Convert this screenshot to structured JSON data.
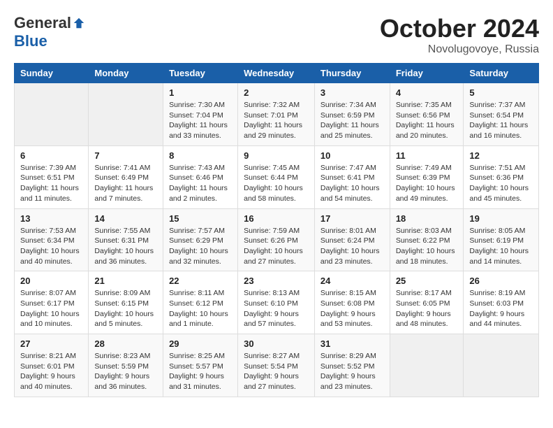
{
  "logo": {
    "general": "General",
    "blue": "Blue"
  },
  "title": {
    "month": "October 2024",
    "location": "Novolugovoye, Russia"
  },
  "weekdays": [
    "Sunday",
    "Monday",
    "Tuesday",
    "Wednesday",
    "Thursday",
    "Friday",
    "Saturday"
  ],
  "weeks": [
    [
      {
        "day": "",
        "sunrise": "",
        "sunset": "",
        "daylight": ""
      },
      {
        "day": "",
        "sunrise": "",
        "sunset": "",
        "daylight": ""
      },
      {
        "day": "1",
        "sunrise": "Sunrise: 7:30 AM",
        "sunset": "Sunset: 7:04 PM",
        "daylight": "Daylight: 11 hours and 33 minutes."
      },
      {
        "day": "2",
        "sunrise": "Sunrise: 7:32 AM",
        "sunset": "Sunset: 7:01 PM",
        "daylight": "Daylight: 11 hours and 29 minutes."
      },
      {
        "day": "3",
        "sunrise": "Sunrise: 7:34 AM",
        "sunset": "Sunset: 6:59 PM",
        "daylight": "Daylight: 11 hours and 25 minutes."
      },
      {
        "day": "4",
        "sunrise": "Sunrise: 7:35 AM",
        "sunset": "Sunset: 6:56 PM",
        "daylight": "Daylight: 11 hours and 20 minutes."
      },
      {
        "day": "5",
        "sunrise": "Sunrise: 7:37 AM",
        "sunset": "Sunset: 6:54 PM",
        "daylight": "Daylight: 11 hours and 16 minutes."
      }
    ],
    [
      {
        "day": "6",
        "sunrise": "Sunrise: 7:39 AM",
        "sunset": "Sunset: 6:51 PM",
        "daylight": "Daylight: 11 hours and 11 minutes."
      },
      {
        "day": "7",
        "sunrise": "Sunrise: 7:41 AM",
        "sunset": "Sunset: 6:49 PM",
        "daylight": "Daylight: 11 hours and 7 minutes."
      },
      {
        "day": "8",
        "sunrise": "Sunrise: 7:43 AM",
        "sunset": "Sunset: 6:46 PM",
        "daylight": "Daylight: 11 hours and 2 minutes."
      },
      {
        "day": "9",
        "sunrise": "Sunrise: 7:45 AM",
        "sunset": "Sunset: 6:44 PM",
        "daylight": "Daylight: 10 hours and 58 minutes."
      },
      {
        "day": "10",
        "sunrise": "Sunrise: 7:47 AM",
        "sunset": "Sunset: 6:41 PM",
        "daylight": "Daylight: 10 hours and 54 minutes."
      },
      {
        "day": "11",
        "sunrise": "Sunrise: 7:49 AM",
        "sunset": "Sunset: 6:39 PM",
        "daylight": "Daylight: 10 hours and 49 minutes."
      },
      {
        "day": "12",
        "sunrise": "Sunrise: 7:51 AM",
        "sunset": "Sunset: 6:36 PM",
        "daylight": "Daylight: 10 hours and 45 minutes."
      }
    ],
    [
      {
        "day": "13",
        "sunrise": "Sunrise: 7:53 AM",
        "sunset": "Sunset: 6:34 PM",
        "daylight": "Daylight: 10 hours and 40 minutes."
      },
      {
        "day": "14",
        "sunrise": "Sunrise: 7:55 AM",
        "sunset": "Sunset: 6:31 PM",
        "daylight": "Daylight: 10 hours and 36 minutes."
      },
      {
        "day": "15",
        "sunrise": "Sunrise: 7:57 AM",
        "sunset": "Sunset: 6:29 PM",
        "daylight": "Daylight: 10 hours and 32 minutes."
      },
      {
        "day": "16",
        "sunrise": "Sunrise: 7:59 AM",
        "sunset": "Sunset: 6:26 PM",
        "daylight": "Daylight: 10 hours and 27 minutes."
      },
      {
        "day": "17",
        "sunrise": "Sunrise: 8:01 AM",
        "sunset": "Sunset: 6:24 PM",
        "daylight": "Daylight: 10 hours and 23 minutes."
      },
      {
        "day": "18",
        "sunrise": "Sunrise: 8:03 AM",
        "sunset": "Sunset: 6:22 PM",
        "daylight": "Daylight: 10 hours and 18 minutes."
      },
      {
        "day": "19",
        "sunrise": "Sunrise: 8:05 AM",
        "sunset": "Sunset: 6:19 PM",
        "daylight": "Daylight: 10 hours and 14 minutes."
      }
    ],
    [
      {
        "day": "20",
        "sunrise": "Sunrise: 8:07 AM",
        "sunset": "Sunset: 6:17 PM",
        "daylight": "Daylight: 10 hours and 10 minutes."
      },
      {
        "day": "21",
        "sunrise": "Sunrise: 8:09 AM",
        "sunset": "Sunset: 6:15 PM",
        "daylight": "Daylight: 10 hours and 5 minutes."
      },
      {
        "day": "22",
        "sunrise": "Sunrise: 8:11 AM",
        "sunset": "Sunset: 6:12 PM",
        "daylight": "Daylight: 10 hours and 1 minute."
      },
      {
        "day": "23",
        "sunrise": "Sunrise: 8:13 AM",
        "sunset": "Sunset: 6:10 PM",
        "daylight": "Daylight: 9 hours and 57 minutes."
      },
      {
        "day": "24",
        "sunrise": "Sunrise: 8:15 AM",
        "sunset": "Sunset: 6:08 PM",
        "daylight": "Daylight: 9 hours and 53 minutes."
      },
      {
        "day": "25",
        "sunrise": "Sunrise: 8:17 AM",
        "sunset": "Sunset: 6:05 PM",
        "daylight": "Daylight: 9 hours and 48 minutes."
      },
      {
        "day": "26",
        "sunrise": "Sunrise: 8:19 AM",
        "sunset": "Sunset: 6:03 PM",
        "daylight": "Daylight: 9 hours and 44 minutes."
      }
    ],
    [
      {
        "day": "27",
        "sunrise": "Sunrise: 8:21 AM",
        "sunset": "Sunset: 6:01 PM",
        "daylight": "Daylight: 9 hours and 40 minutes."
      },
      {
        "day": "28",
        "sunrise": "Sunrise: 8:23 AM",
        "sunset": "Sunset: 5:59 PM",
        "daylight": "Daylight: 9 hours and 36 minutes."
      },
      {
        "day": "29",
        "sunrise": "Sunrise: 8:25 AM",
        "sunset": "Sunset: 5:57 PM",
        "daylight": "Daylight: 9 hours and 31 minutes."
      },
      {
        "day": "30",
        "sunrise": "Sunrise: 8:27 AM",
        "sunset": "Sunset: 5:54 PM",
        "daylight": "Daylight: 9 hours and 27 minutes."
      },
      {
        "day": "31",
        "sunrise": "Sunrise: 8:29 AM",
        "sunset": "Sunset: 5:52 PM",
        "daylight": "Daylight: 9 hours and 23 minutes."
      },
      {
        "day": "",
        "sunrise": "",
        "sunset": "",
        "daylight": ""
      },
      {
        "day": "",
        "sunrise": "",
        "sunset": "",
        "daylight": ""
      }
    ]
  ]
}
